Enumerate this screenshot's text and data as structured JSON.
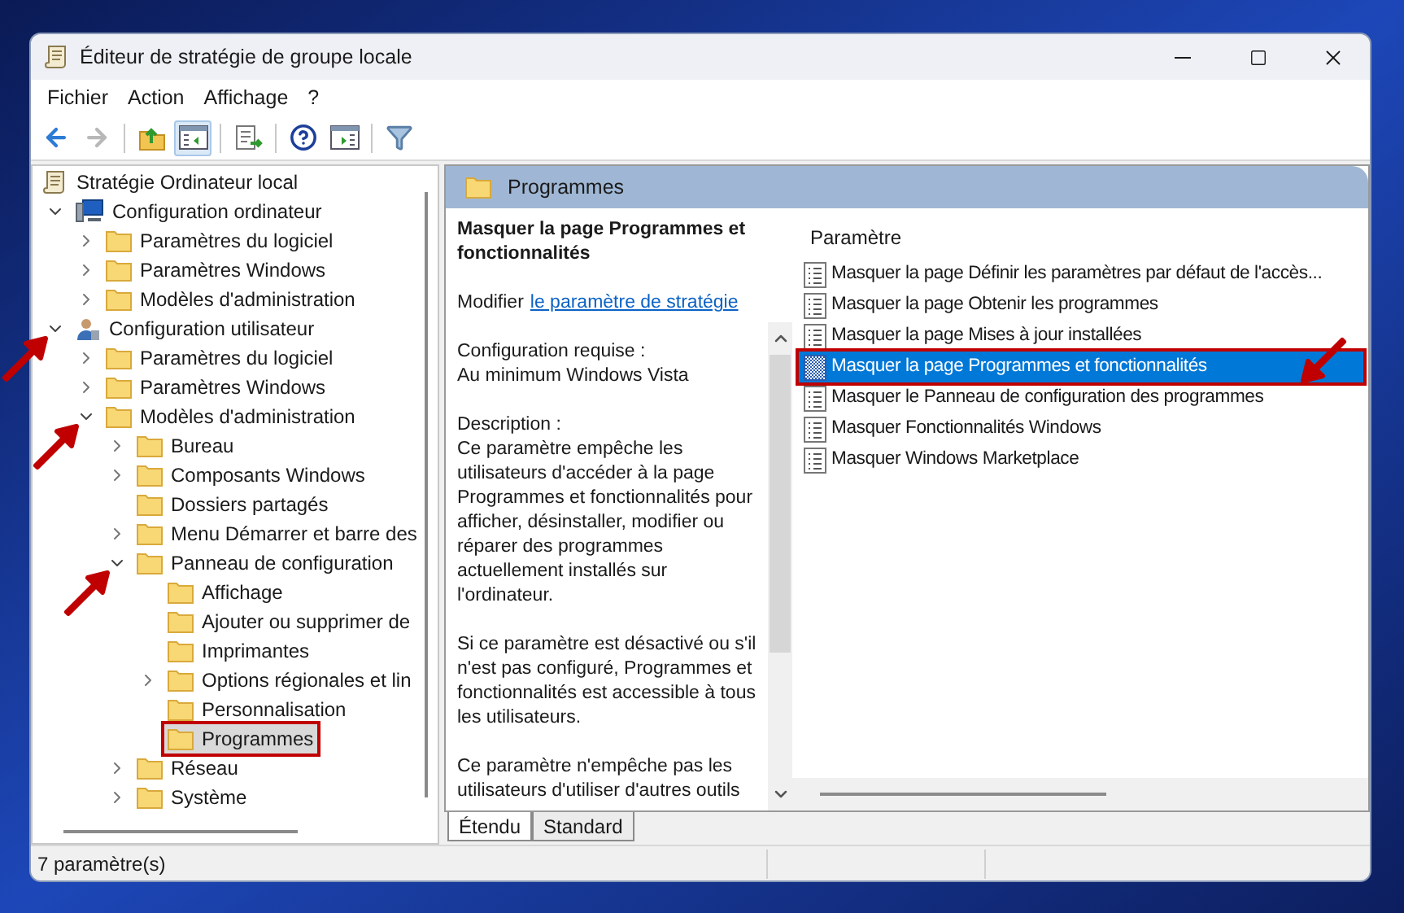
{
  "window": {
    "title": "Éditeur de stratégie de groupe locale"
  },
  "menu": [
    "Fichier",
    "Action",
    "Affichage",
    "?"
  ],
  "toolbar": [
    {
      "kind": "back",
      "pressed": false,
      "disabled": false
    },
    {
      "kind": "forward",
      "pressed": false,
      "disabled": true
    },
    {
      "kind": "up",
      "pressed": false,
      "disabled": false
    },
    {
      "kind": "tree",
      "pressed": true,
      "disabled": false
    },
    {
      "kind": "export",
      "pressed": false,
      "disabled": false
    },
    {
      "kind": "help",
      "pressed": false,
      "disabled": false
    },
    {
      "kind": "pane",
      "pressed": false,
      "disabled": false
    },
    {
      "kind": "filter",
      "pressed": false,
      "disabled": false
    }
  ],
  "tree": {
    "label": "Stratégie Ordinateur local",
    "kind": "scroll",
    "selected": false,
    "children": [
      {
        "label": "Configuration ordinateur",
        "kind": "computer",
        "expanded": true,
        "selected": false,
        "children": [
          {
            "label": "Paramètres du logiciel",
            "kind": "folder",
            "expanded": false,
            "selected": false
          },
          {
            "label": "Paramètres Windows",
            "kind": "folder",
            "expanded": false,
            "selected": false
          },
          {
            "label": "Modèles d'administration",
            "kind": "folder",
            "expanded": false,
            "selected": false
          }
        ]
      },
      {
        "label": "Configuration utilisateur",
        "kind": "user",
        "expanded": true,
        "selected": false,
        "arrow": true,
        "children": [
          {
            "label": "Paramètres du logiciel",
            "kind": "folder",
            "expanded": false,
            "selected": false
          },
          {
            "label": "Paramètres Windows",
            "kind": "folder",
            "expanded": false,
            "selected": false
          },
          {
            "label": "Modèles d'administration",
            "kind": "folder",
            "expanded": true,
            "selected": false,
            "arrow": true,
            "children": [
              {
                "label": "Bureau",
                "kind": "folder",
                "expanded": false,
                "selected": false
              },
              {
                "label": "Composants Windows",
                "kind": "folder",
                "expanded": false,
                "selected": false
              },
              {
                "label": "Dossiers partagés",
                "kind": "folder",
                "selected": false
              },
              {
                "label": "Menu Démarrer et barre des",
                "kind": "folder",
                "expanded": false,
                "selected": false
              },
              {
                "label": "Panneau de configuration",
                "kind": "folder",
                "expanded": true,
                "selected": false,
                "arrow": true,
                "children": [
                  {
                    "label": "Affichage",
                    "kind": "folder",
                    "selected": false
                  },
                  {
                    "label": "Ajouter ou supprimer de",
                    "kind": "folder",
                    "selected": false
                  },
                  {
                    "label": "Imprimantes",
                    "kind": "folder",
                    "selected": false
                  },
                  {
                    "label": "Options régionales et lin",
                    "kind": "folder",
                    "expanded": false,
                    "selected": false
                  },
                  {
                    "label": "Personnalisation",
                    "kind": "folder",
                    "selected": false
                  },
                  {
                    "label": "Programmes",
                    "kind": "folder",
                    "selected": true,
                    "highlighted": true
                  }
                ]
              },
              {
                "label": "Réseau",
                "kind": "folder",
                "expanded": false,
                "selected": false
              },
              {
                "label": "Système",
                "kind": "folder",
                "expanded": false,
                "selected": false
              }
            ]
          }
        ]
      }
    ]
  },
  "details": {
    "header": "Programmes",
    "description": {
      "title": "Masquer la page Programmes et fonctionnalités",
      "edit_prefix": "Modifier",
      "edit_link": "le paramètre de stratégie",
      "paragraphs": [
        "Configuration requise :\nAu minimum Windows Vista",
        "Description :\nCe paramètre empêche les utilisateurs d'accéder à la page Programmes et fonctionnalités pour afficher, désinstaller, modifier ou réparer des programmes actuellement installés sur l'ordinateur.",
        "Si ce paramètre est désactivé ou s'il n'est pas configuré, Programmes et fonctionnalités est accessible à tous les utilisateurs.",
        "Ce paramètre n'empêche pas les utilisateurs d'utiliser d'autres outils"
      ]
    },
    "list": {
      "column": "Paramètre",
      "rows": [
        {
          "label": "Masquer la page Définir les paramètres par défaut de l'accès...",
          "selected": false,
          "highlighted": false,
          "arrow": false
        },
        {
          "label": "Masquer la page Obtenir les programmes",
          "selected": false,
          "highlighted": false,
          "arrow": false
        },
        {
          "label": "Masquer la page Mises à jour installées",
          "selected": false,
          "highlighted": false,
          "arrow": false
        },
        {
          "label": "Masquer la page Programmes et fonctionnalités",
          "selected": true,
          "highlighted": true,
          "arrow": true
        },
        {
          "label": "Masquer le Panneau de configuration des programmes",
          "selected": false,
          "highlighted": false,
          "arrow": false
        },
        {
          "label": "Masquer Fonctionnalités Windows",
          "selected": false,
          "highlighted": false,
          "arrow": false
        },
        {
          "label": "Masquer Windows Marketplace",
          "selected": false,
          "highlighted": false,
          "arrow": false
        }
      ]
    },
    "tabs": [
      {
        "label": "Étendu",
        "selected": true
      },
      {
        "label": "Standard",
        "selected": false
      }
    ]
  },
  "status_bar": "7 paramètre(s)"
}
